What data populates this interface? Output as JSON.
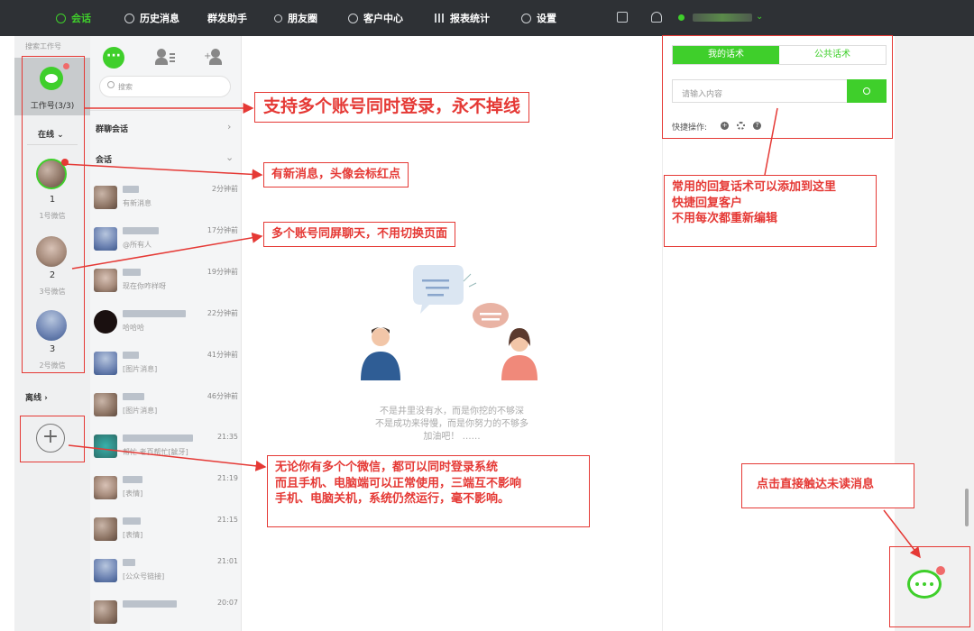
{
  "nav": {
    "items": [
      {
        "label": "会话",
        "icon": "chat-icon",
        "active": true
      },
      {
        "label": "历史消息",
        "icon": "clock-icon"
      },
      {
        "label": "群发助手",
        "icon": ""
      },
      {
        "label": "朋友圈",
        "icon": "moments-icon"
      },
      {
        "label": "客户中心",
        "icon": "person-icon"
      },
      {
        "label": "报表统计",
        "icon": "bar-chart-icon"
      },
      {
        "label": "设置",
        "icon": "gear-icon"
      }
    ]
  },
  "accounts": {
    "search_label": "搜索工作号",
    "work_label": "工作号(3/3)",
    "online_label": "在线",
    "offline_label": "离线",
    "list": [
      {
        "index": "1",
        "name": "1号微信"
      },
      {
        "index": "2",
        "name": "3号微信"
      },
      {
        "index": "3",
        "name": "2号微信"
      }
    ]
  },
  "chats": {
    "search_placeholder": "搜索",
    "group_section": "群聊会话",
    "session_section": "会话",
    "items": [
      {
        "time": "2分钟前",
        "preview": "有新消息"
      },
      {
        "time": "17分钟前",
        "preview": "@所有人"
      },
      {
        "time": "19分钟前",
        "preview": "现在你咋样呀"
      },
      {
        "time": "22分钟前",
        "preview": "哈哈哈"
      },
      {
        "time": "41分钟前",
        "preview": "[图片消息]"
      },
      {
        "time": "46分钟前",
        "preview": "[图片消息]"
      },
      {
        "time": "21:35",
        "preview": "帮忙 老百帮忙[龇牙]"
      },
      {
        "time": "21:19",
        "preview": "[表情]"
      },
      {
        "time": "21:15",
        "preview": "[表情]"
      },
      {
        "time": "21:01",
        "preview": "[公众号链接]"
      },
      {
        "time": "20:07",
        "preview": ""
      }
    ]
  },
  "center": {
    "quote_line1": "不是井里没有水，而是你挖的不够深",
    "quote_line2": "不是成功来得慢，而是你努力的不够多",
    "quote_line3": "加油吧！ ……"
  },
  "phrases": {
    "tab_mine": "我的话术",
    "tab_public": "公共话术",
    "input_placeholder": "请输入内容",
    "shortcut_label": "快捷操作:"
  },
  "callouts": {
    "multi_login": "支持多个账号同时登录，永不掉线",
    "new_message": "有新消息，头像会标红点",
    "same_screen": "多个账号同屏聊天，不用切换页面",
    "phrases_line1": "常用的回复话术可以添加到这里",
    "phrases_line2": "快捷回复客户",
    "phrases_line3": "不用每次都重新编辑",
    "multi_device_line1": "无论你有多个个微信，都可以同时登录系统",
    "multi_device_line2": "而且手机、电脑端可以正常使用，三端互不影响",
    "multi_device_line3": "手机、电脑关机，系统仍然运行，毫不影响。",
    "unread": "点击直接触达未读消息"
  },
  "colors": {
    "accent": "#3fcf2b",
    "topbar": "#2e3135",
    "annotation": "#e53935"
  }
}
